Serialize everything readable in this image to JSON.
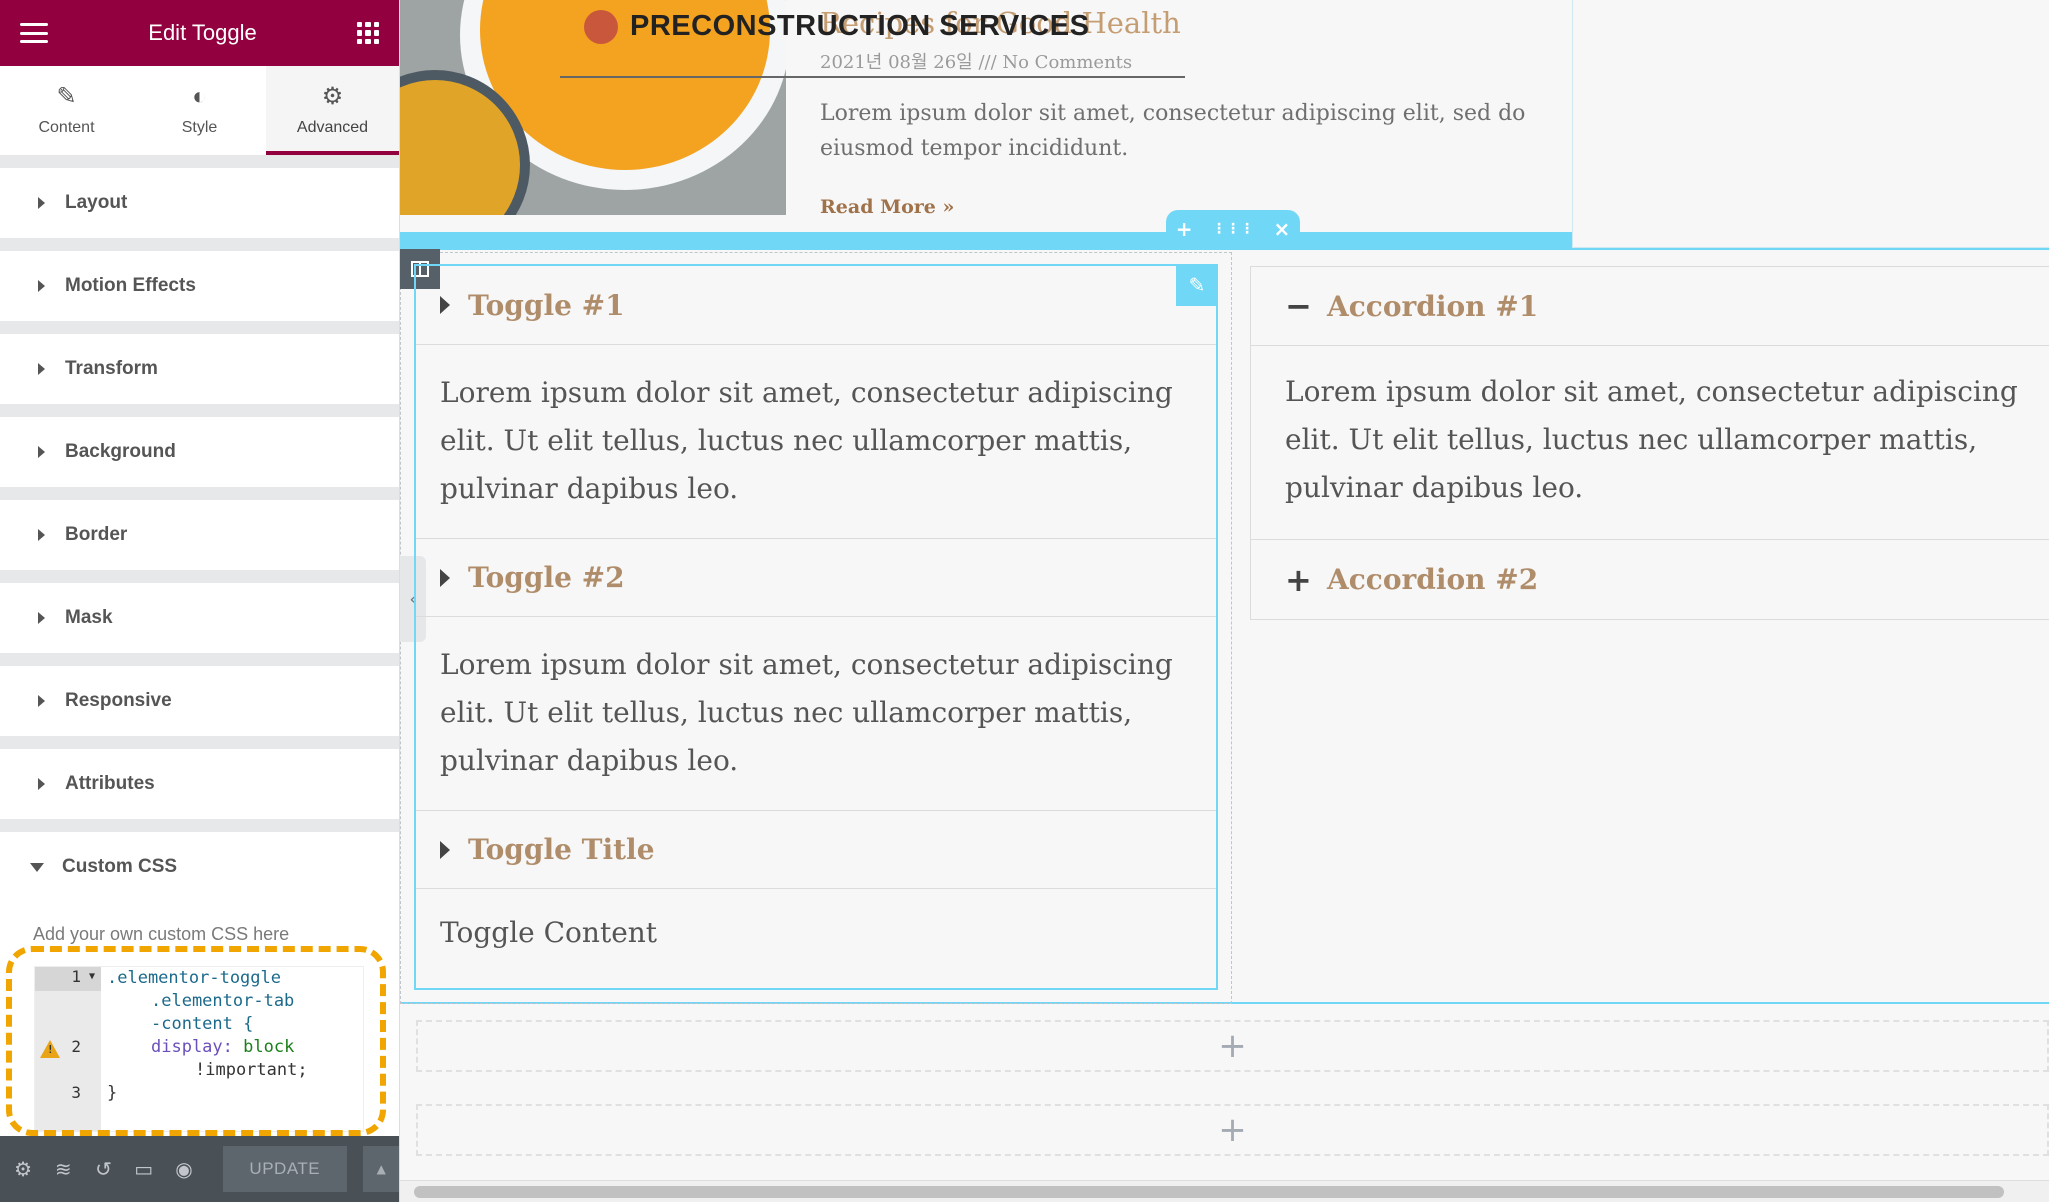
{
  "panel": {
    "title": "Edit Toggle",
    "tabs": [
      {
        "label": "Content",
        "icon": "pencil-icon"
      },
      {
        "label": "Style",
        "icon": "contrast-icon"
      },
      {
        "label": "Advanced",
        "icon": "gear-icon",
        "active": true
      }
    ],
    "sections": [
      "Layout",
      "Motion Effects",
      "Transform",
      "Background",
      "Border",
      "Mask",
      "Responsive",
      "Attributes"
    ],
    "custom_css": {
      "label": "Custom CSS",
      "hint": "Add your own custom CSS here",
      "line_numbers": [
        "1",
        "2",
        "3"
      ],
      "code": {
        "l1": ".elementor-toggle",
        "l1b": ".elementor-tab",
        "l1c": "-content {",
        "l2_prop": "display:",
        "l2_val": "block",
        "l2b": "!important;",
        "l3": "}"
      }
    },
    "footer": {
      "update_label": "UPDATE",
      "icons": [
        "settings-icon",
        "layers-icon",
        "history-icon",
        "responsive-icon",
        "preview-icon"
      ]
    }
  },
  "preview": {
    "site_name": "PRECONSTRUCTION SERVICES",
    "post": {
      "title_fragment": "Recipes for Good Health",
      "meta": "2021년 08월 26일 /// No Comments",
      "excerpt": "Lorem ipsum dolor sit amet, consectetur adipiscing elit, sed do eiusmod tempor incididunt.",
      "read_more": "Read More »"
    },
    "toggle": {
      "items": [
        {
          "title": "Toggle #1",
          "content": "Lorem ipsum dolor sit amet, consectetur adipiscing elit. Ut elit tellus, luctus nec ullamcorper mattis, pulvinar dapibus leo."
        },
        {
          "title": "Toggle #2",
          "content": "Lorem ipsum dolor sit amet, consectetur adipiscing elit. Ut elit tellus, luctus nec ullamcorper mattis, pulvinar dapibus leo."
        },
        {
          "title": "Toggle Title",
          "content": "Toggle Content"
        }
      ]
    },
    "accordion": {
      "items": [
        {
          "title": "Accordion #1",
          "icon": "−",
          "open": true,
          "content": "Lorem ipsum dolor sit amet, consectetur adipiscing elit. Ut elit tellus, luctus nec ullamcorper mattis, pulvinar dapibus leo."
        },
        {
          "title": "Accordion #2",
          "icon": "+",
          "open": false
        }
      ]
    },
    "section_handle": {
      "add": "+",
      "move": "⋮⋮⋮",
      "close": "×"
    },
    "add_section_plus": "+"
  },
  "colors": {
    "brand": "#93003f",
    "editor_accent": "#71d7f7",
    "title_brown": "#b08d6a",
    "highlight": "#f0a500"
  }
}
